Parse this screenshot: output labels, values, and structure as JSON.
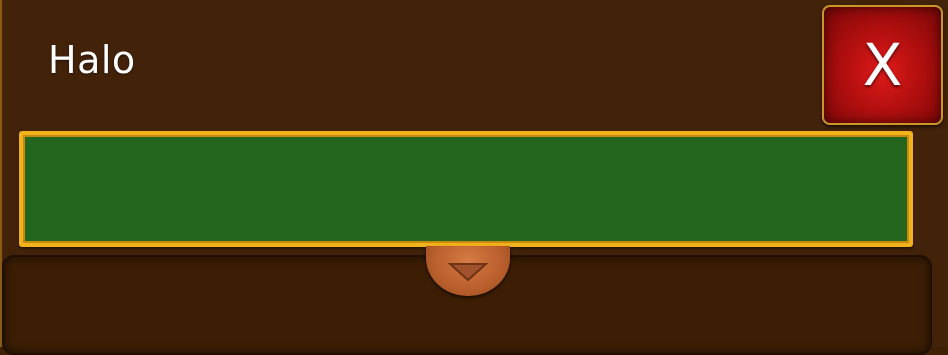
{
  "dialog": {
    "title": "Halo",
    "close_label": "X",
    "name_input_value": "",
    "colors": {
      "background": "#43220a",
      "input_fill": "#25661f",
      "input_border": "#f2b21c",
      "close_button": "#b20f0f",
      "knob": "#b85e2d"
    }
  },
  "icons": {
    "dropdown": "chevron-down-icon",
    "close": "close-icon"
  }
}
